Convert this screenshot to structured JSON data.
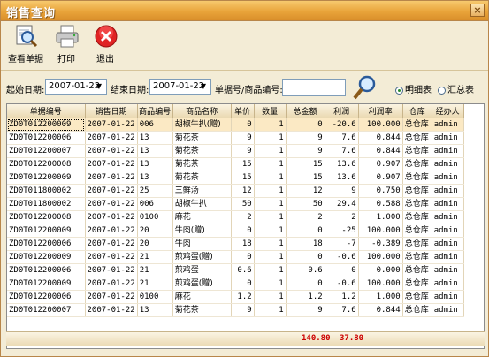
{
  "window": {
    "title": "销售查询",
    "close_glyph": "×"
  },
  "toolbar": {
    "buttons": [
      {
        "label": "查看单据",
        "icon": "magnifier-document-icon"
      },
      {
        "label": "打印",
        "icon": "printer-icon"
      },
      {
        "label": "退出",
        "icon": "exit-x-icon"
      }
    ]
  },
  "filter": {
    "start_label": "起始日期:",
    "start_value": "2007-01-22",
    "end_label": "结束日期:",
    "end_value": "2007-01-22",
    "code_label": "单据号/商品编号:",
    "code_value": "",
    "detail_label": "明细表",
    "summary_label": "汇总表",
    "selected": "明细表"
  },
  "table": {
    "columns": [
      "单据编号",
      "销售日期",
      "商品编号",
      "商品名称",
      "单价",
      "数量",
      "总金额",
      "利润",
      "利润率",
      "仓库",
      "经办人"
    ],
    "rows": [
      [
        "ZD0T012200009",
        "2007-01-22",
        "006",
        "胡椒牛扒(赠)",
        "0",
        "1",
        "0",
        "-20.6",
        "100.000",
        "总仓库",
        "admin"
      ],
      [
        "ZD0T012200006",
        "2007-01-22",
        "13",
        "菊花茶",
        "9",
        "1",
        "9",
        "7.6",
        "0.844",
        "总仓库",
        "admin"
      ],
      [
        "ZD0T012200007",
        "2007-01-22",
        "13",
        "菊花茶",
        "9",
        "1",
        "9",
        "7.6",
        "0.844",
        "总仓库",
        "admin"
      ],
      [
        "ZD0T012200008",
        "2007-01-22",
        "13",
        "菊花茶",
        "15",
        "1",
        "15",
        "13.6",
        "0.907",
        "总仓库",
        "admin"
      ],
      [
        "ZD0T012200009",
        "2007-01-22",
        "13",
        "菊花茶",
        "15",
        "1",
        "15",
        "13.6",
        "0.907",
        "总仓库",
        "admin"
      ],
      [
        "ZD0T011800002",
        "2007-01-22",
        "25",
        "三鲜汤",
        "12",
        "1",
        "12",
        "9",
        "0.750",
        "总仓库",
        "admin"
      ],
      [
        "ZD0T011800002",
        "2007-01-22",
        "006",
        "胡椒牛扒",
        "50",
        "1",
        "50",
        "29.4",
        "0.588",
        "总仓库",
        "admin"
      ],
      [
        "ZD0T012200008",
        "2007-01-22",
        "0100",
        "麻花",
        "2",
        "1",
        "2",
        "2",
        "1.000",
        "总仓库",
        "admin"
      ],
      [
        "ZD0T012200009",
        "2007-01-22",
        "20",
        "牛肉(赠)",
        "0",
        "1",
        "0",
        "-25",
        "100.000",
        "总仓库",
        "admin"
      ],
      [
        "ZD0T012200006",
        "2007-01-22",
        "20",
        "牛肉",
        "18",
        "1",
        "18",
        "-7",
        "-0.389",
        "总仓库",
        "admin"
      ],
      [
        "ZD0T012200009",
        "2007-01-22",
        "21",
        "煎鸡蛋(赠)",
        "0",
        "1",
        "0",
        "-0.6",
        "100.000",
        "总仓库",
        "admin"
      ],
      [
        "ZD0T012200006",
        "2007-01-22",
        "21",
        "煎鸡蛋",
        "0.6",
        "1",
        "0.6",
        "0",
        "0.000",
        "总仓库",
        "admin"
      ],
      [
        "ZD0T012200009",
        "2007-01-22",
        "21",
        "煎鸡蛋(赠)",
        "0",
        "1",
        "0",
        "-0.6",
        "100.000",
        "总仓库",
        "admin"
      ],
      [
        "ZD0T012200006",
        "2007-01-22",
        "0100",
        "麻花",
        "1.2",
        "1",
        "1.2",
        "1.2",
        "1.000",
        "总仓库",
        "admin"
      ],
      [
        "ZD0T012200007",
        "2007-01-22",
        "13",
        "菊花茶",
        "9",
        "1",
        "9",
        "7.6",
        "0.844",
        "总仓库",
        "admin"
      ]
    ],
    "total_amount": "140.80",
    "total_profit": "37.80"
  },
  "colors": {
    "title_bar": "#e9a43a",
    "window_bg": "#f3ecd6",
    "total_red": "#cc0000",
    "selected_row": "#fbe9c4"
  }
}
